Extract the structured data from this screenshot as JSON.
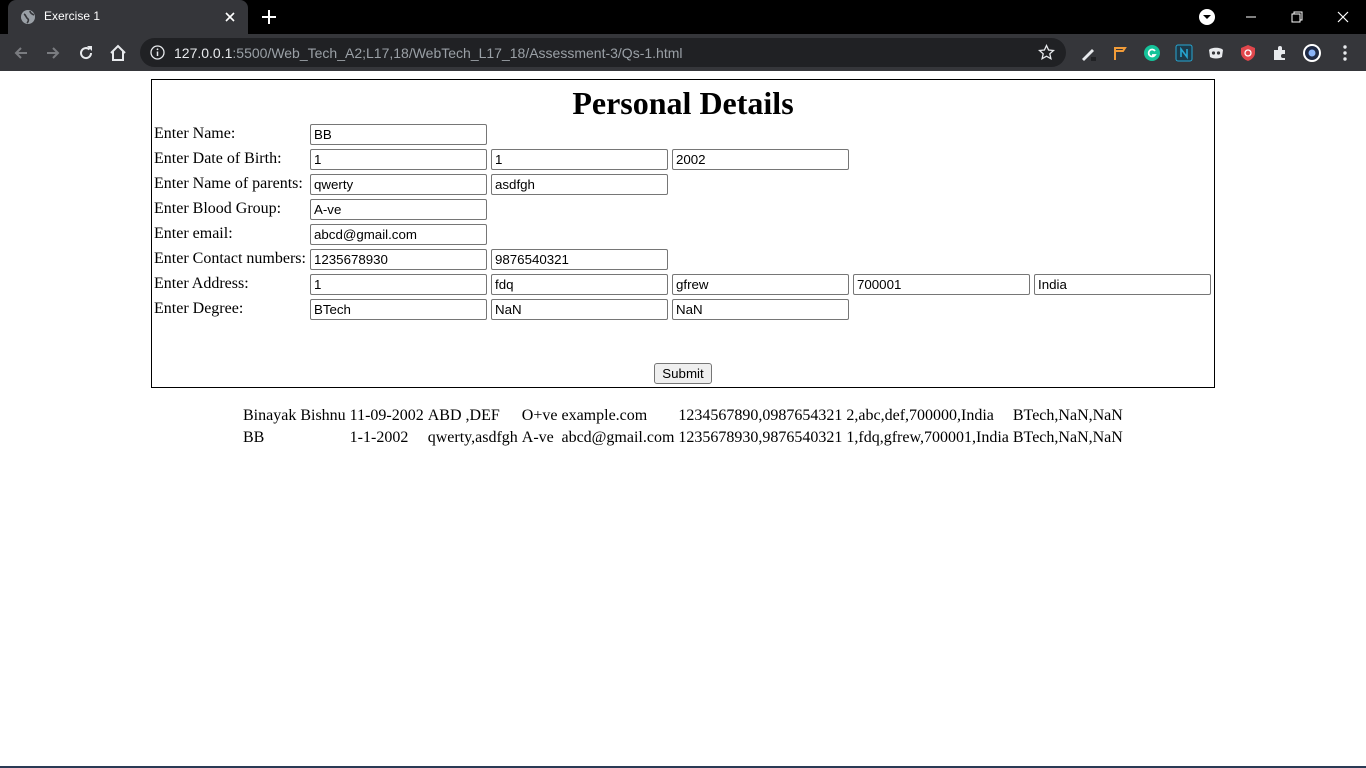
{
  "browser": {
    "tab_title": "Exercise 1",
    "url_host": "127.0.0.1",
    "url_rest": ":5500/Web_Tech_A2;L17,18/WebTech_L17_18/Assessment-3/Qs-1.html"
  },
  "page": {
    "title": "Personal Details",
    "labels": {
      "name": "Enter Name:",
      "dob": "Enter Date of Birth:",
      "parents": "Enter Name of parents:",
      "blood": "Enter Blood Group:",
      "email": "Enter email:",
      "contact": "Enter Contact numbers:",
      "address": "Enter Address:",
      "degree": "Enter Degree:"
    },
    "fields": {
      "name": "BB",
      "dob_day": "1",
      "dob_month": "1",
      "dob_year": "2002",
      "parent1": "qwerty",
      "parent2": "asdfgh",
      "blood": "A-ve",
      "email": "abcd@gmail.com",
      "contact1": "1235678930",
      "contact2": "9876540321",
      "address1": "1",
      "address2": "fdq",
      "address3": "gfrew",
      "address4": "700001",
      "address5": "India",
      "degree1": "BTech",
      "degree2": "NaN",
      "degree3": "NaN"
    },
    "submit_label": "Submit"
  },
  "results": [
    [
      "Binayak Bishnu",
      "11-09-2002",
      "ABD ,DEF",
      "O+ve",
      "example.com",
      "1234567890,0987654321",
      "2,abc,def,700000,India",
      "BTech,NaN,NaN"
    ],
    [
      "BB",
      "1-1-2002",
      "qwerty,asdfgh",
      "A-ve",
      "abcd@gmail.com",
      "1235678930,9876540321",
      "1,fdq,gfrew,700001,India",
      "BTech,NaN,NaN"
    ]
  ]
}
